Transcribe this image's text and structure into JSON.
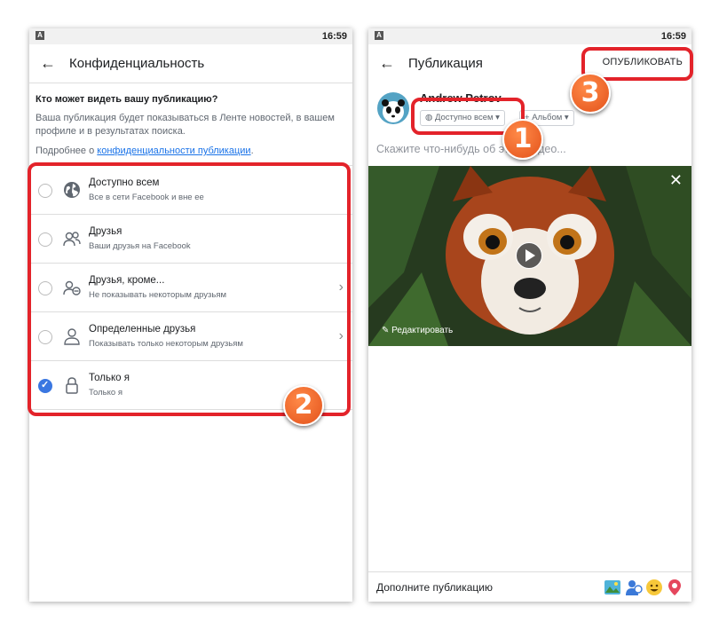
{
  "left": {
    "status": {
      "icon": "A",
      "time": "16:59"
    },
    "appbar": {
      "back_icon": "←",
      "title": "Конфиденциальность"
    },
    "question": {
      "title": "Кто может видеть вашу публикацию?",
      "description": "Ваша публикация будет показываться в Ленте новостей, в вашем профиле и в результатах поиска.",
      "more_prefix": "Подробнее о ",
      "more_link": "конфиденциальности публикации",
      "more_suffix": "."
    },
    "options": [
      {
        "title": "Доступно всем",
        "subtitle": "Все в сети Facebook и вне ее",
        "icon": "globe-icon",
        "checked": false,
        "chevron": false
      },
      {
        "title": "Друзья",
        "subtitle": "Ваши друзья на Facebook",
        "icon": "friends-icon",
        "checked": false,
        "chevron": false
      },
      {
        "title": "Друзья, кроме...",
        "subtitle": "Не показывать некоторым друзьям",
        "icon": "friends-except-icon",
        "checked": false,
        "chevron": true
      },
      {
        "title": "Определенные друзья",
        "subtitle": "Показывать только некоторым друзьям",
        "icon": "person-icon",
        "checked": false,
        "chevron": true
      },
      {
        "title": "Только я",
        "subtitle": "Только я",
        "icon": "lock-icon",
        "checked": true,
        "chevron": false
      }
    ],
    "badge": "2"
  },
  "right": {
    "status": {
      "icon": "A",
      "time": "16:59"
    },
    "appbar": {
      "back_icon": "←",
      "title": "Публикация",
      "publish": "ОПУБЛИКОВАТЬ"
    },
    "author": {
      "name": "Andrew Petrov",
      "privacy_chip": "Доступно всем",
      "album_chip": "Альбом"
    },
    "composer_placeholder": "Скажите что-нибудь об этом видео...",
    "media": {
      "edit_label": "Редактировать",
      "close_icon": "✕"
    },
    "footer": {
      "text": "Дополните публикацию",
      "icons": [
        "photo-icon",
        "tag-people-icon",
        "feeling-icon",
        "location-icon"
      ]
    },
    "badges": [
      "1",
      "3"
    ]
  },
  "colors": {
    "accent_red": "#e3232a",
    "badge_orange": "#ef6a2c",
    "link_blue": "#1a73e8",
    "check_blue": "#3a77e1"
  }
}
